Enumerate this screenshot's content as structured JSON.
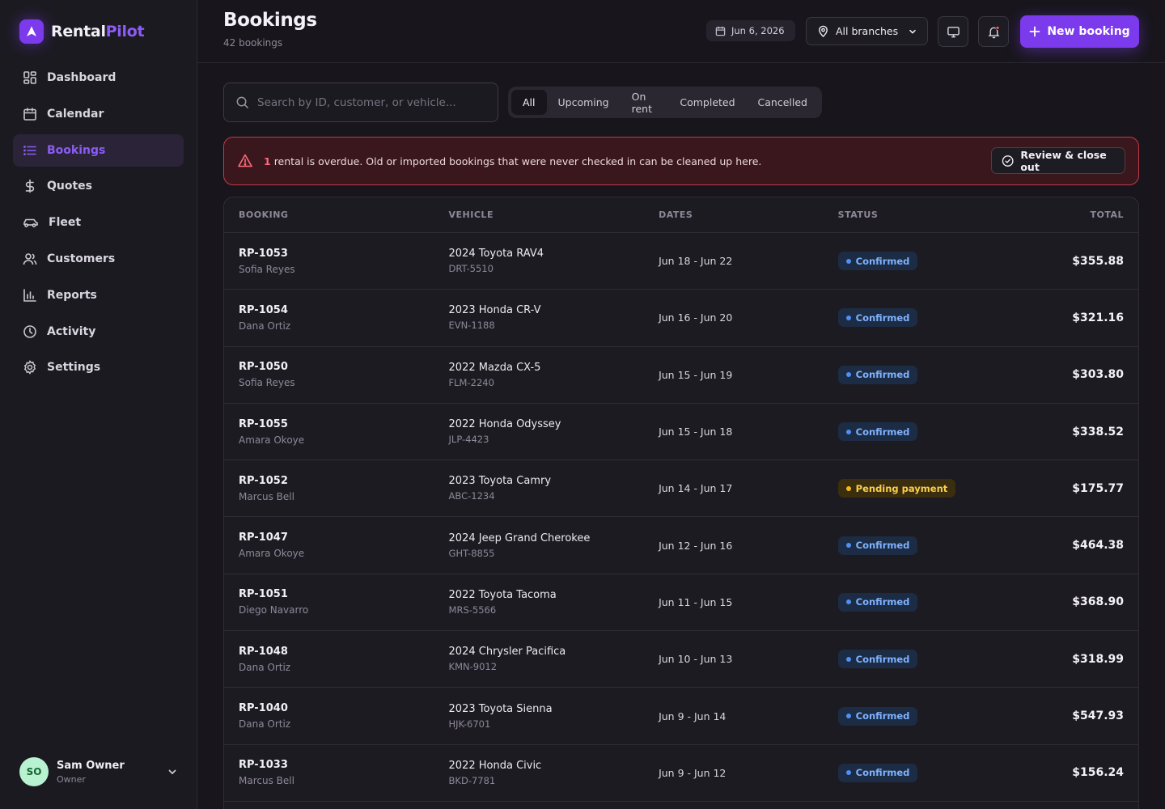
{
  "brand": {
    "name_a": "Rental",
    "name_b": "Pilot"
  },
  "sidebar": {
    "items": [
      {
        "label": "Dashboard",
        "icon": "dashboard-icon"
      },
      {
        "label": "Calendar",
        "icon": "calendar-icon"
      },
      {
        "label": "Bookings",
        "icon": "list-icon",
        "active": true
      },
      {
        "label": "Quotes",
        "icon": "dollar-icon"
      },
      {
        "label": "Fleet",
        "icon": "car-icon"
      },
      {
        "label": "Customers",
        "icon": "users-icon"
      },
      {
        "label": "Reports",
        "icon": "bar-chart-icon"
      },
      {
        "label": "Activity",
        "icon": "clock-icon"
      },
      {
        "label": "Settings",
        "icon": "gear-icon"
      }
    ]
  },
  "user": {
    "initials": "SO",
    "name": "Sam Owner",
    "role": "Owner"
  },
  "header": {
    "title": "Bookings",
    "subtitle": "42 bookings",
    "date": "Jun 6, 2026",
    "branch": "All branches",
    "new_booking": "New booking"
  },
  "search": {
    "placeholder": "Search by ID, customer, or vehicle..."
  },
  "filters": {
    "tabs": [
      "All",
      "Upcoming",
      "On rent",
      "Completed",
      "Cancelled"
    ],
    "active": "All"
  },
  "alert": {
    "count": "1",
    "message": "rental is overdue. Old or imported bookings that were never checked in can be cleaned up here.",
    "action": "Review & close out"
  },
  "table": {
    "headers": {
      "booking": "BOOKING",
      "vehicle": "VEHICLE",
      "dates": "DATES",
      "status": "STATUS",
      "total": "TOTAL"
    },
    "rows": [
      {
        "id": "RP-1053",
        "customer": "Sofia Reyes",
        "vehicle": "2024 Toyota RAV4",
        "plate": "DRT-5510",
        "dates": "Jun 18 - Jun 22",
        "status": "Confirmed",
        "total": "$355.88"
      },
      {
        "id": "RP-1054",
        "customer": "Dana Ortiz",
        "vehicle": "2023 Honda CR-V",
        "plate": "EVN-1188",
        "dates": "Jun 16 - Jun 20",
        "status": "Confirmed",
        "total": "$321.16"
      },
      {
        "id": "RP-1050",
        "customer": "Sofia Reyes",
        "vehicle": "2022 Mazda CX-5",
        "plate": "FLM-2240",
        "dates": "Jun 15 - Jun 19",
        "status": "Confirmed",
        "total": "$303.80"
      },
      {
        "id": "RP-1055",
        "customer": "Amara Okoye",
        "vehicle": "2022 Honda Odyssey",
        "plate": "JLP-4423",
        "dates": "Jun 15 - Jun 18",
        "status": "Confirmed",
        "total": "$338.52"
      },
      {
        "id": "RP-1052",
        "customer": "Marcus Bell",
        "vehicle": "2023 Toyota Camry",
        "plate": "ABC-1234",
        "dates": "Jun 14 - Jun 17",
        "status": "Pending payment",
        "total": "$175.77"
      },
      {
        "id": "RP-1047",
        "customer": "Amara Okoye",
        "vehicle": "2024 Jeep Grand Cherokee",
        "plate": "GHT-8855",
        "dates": "Jun 12 - Jun 16",
        "status": "Confirmed",
        "total": "$464.38"
      },
      {
        "id": "RP-1051",
        "customer": "Diego Navarro",
        "vehicle": "2022 Toyota Tacoma",
        "plate": "MRS-5566",
        "dates": "Jun 11 - Jun 15",
        "status": "Confirmed",
        "total": "$368.90"
      },
      {
        "id": "RP-1048",
        "customer": "Dana Ortiz",
        "vehicle": "2024 Chrysler Pacifica",
        "plate": "KMN-9012",
        "dates": "Jun 10 - Jun 13",
        "status": "Confirmed",
        "total": "$318.99"
      },
      {
        "id": "RP-1040",
        "customer": "Dana Ortiz",
        "vehicle": "2023 Toyota Sienna",
        "plate": "HJK-6701",
        "dates": "Jun 9 - Jun 14",
        "status": "Confirmed",
        "total": "$547.93"
      },
      {
        "id": "RP-1033",
        "customer": "Marcus Bell",
        "vehicle": "2022 Honda Civic",
        "plate": "BKD-7781",
        "dates": "Jun 9 - Jun 12",
        "status": "Confirmed",
        "total": "$156.24"
      }
    ]
  },
  "colors": {
    "accent": "#7c3aed",
    "confirmed": "#4f8ff7",
    "pending": "#f5b81a",
    "alert": "#c2394a"
  }
}
